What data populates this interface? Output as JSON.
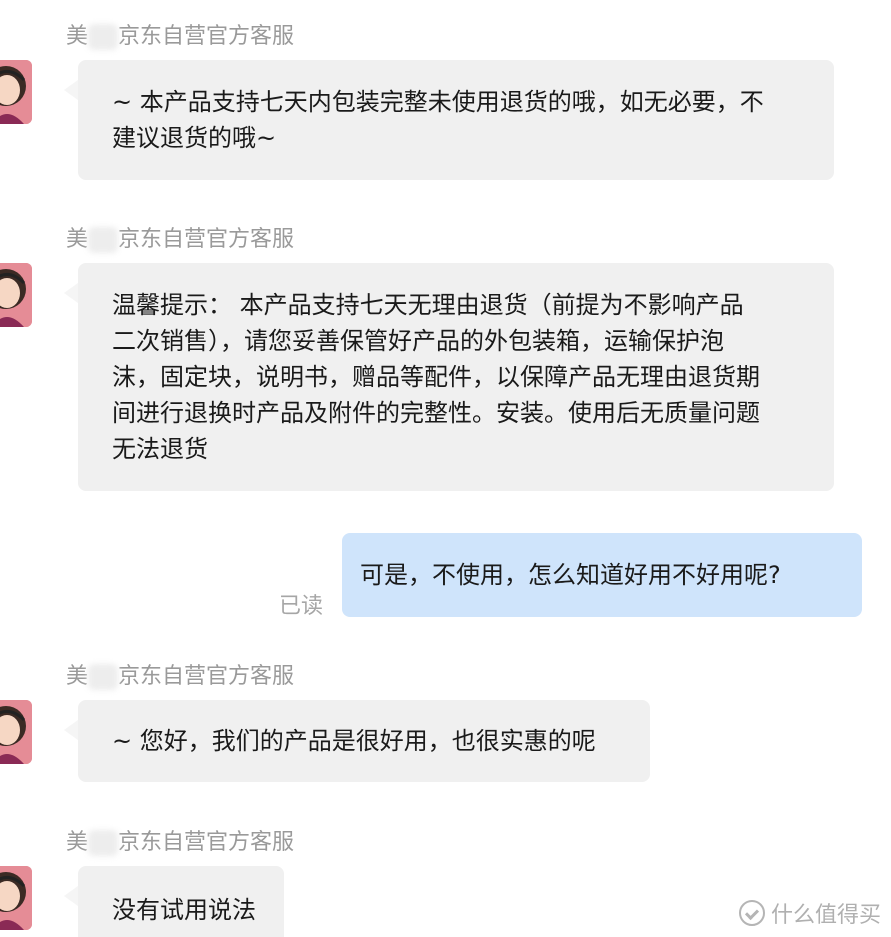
{
  "messages": [
    {
      "sender_prefix": "美",
      "sender_suffix": "京东自营官方客服",
      "lines": [
        "~ 本产品支持七天内包装完整未使用退货的哦，如无必要，不",
        "建议退货的哦~"
      ]
    },
    {
      "sender_prefix": "美",
      "sender_suffix": "京东自营官方客服",
      "lines": [
        "温馨提示： 本产品支持七天无理由退货（前提为不影响产品",
        "二次销售），请您妥善保管好产品的外包装箱，运输保护泡",
        "沫，固定块，说明书，赠品等配件，以保障产品无理由退货期",
        "间进行退换时产品及附件的完整性。安装。使用后无质量问题",
        "无法退货"
      ]
    },
    {
      "mine": true,
      "lines": [
        "可是，不使用，怎么知道好用不好用呢?"
      ],
      "status": "已读"
    },
    {
      "sender_prefix": "美",
      "sender_suffix": "京东自营官方客服",
      "lines": [
        "~ 您好，我们的产品是很好用，也很实惠的呢"
      ]
    },
    {
      "sender_prefix": "美",
      "sender_suffix": "京东自营官方客服",
      "lines": [
        "没有试用说法"
      ]
    }
  ],
  "watermark": "什么值得买",
  "colors": {
    "bubble_bg": "#f0f0f0",
    "mine_bubble_bg": "#cfe4fb",
    "avatar_bg": "#e58c96",
    "meta_text": "#9a9a9a"
  }
}
